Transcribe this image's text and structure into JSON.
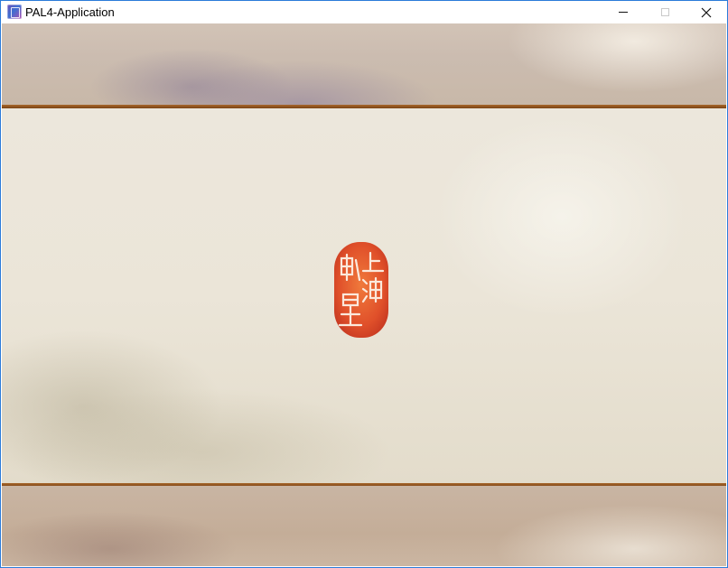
{
  "window": {
    "title": "PAL4-Application",
    "app_icon": "pal4-app-icon",
    "controls": {
      "minimize": "minimize-icon",
      "maximize": "maximize-icon",
      "close": "close-icon"
    }
  },
  "scene": {
    "seal_text": "上海軟星",
    "colors": {
      "seal": "#e0502a",
      "scroll_edge": "#8f5220",
      "parchment": "#ebe5d8",
      "window_border": "#2b7bd9"
    }
  }
}
